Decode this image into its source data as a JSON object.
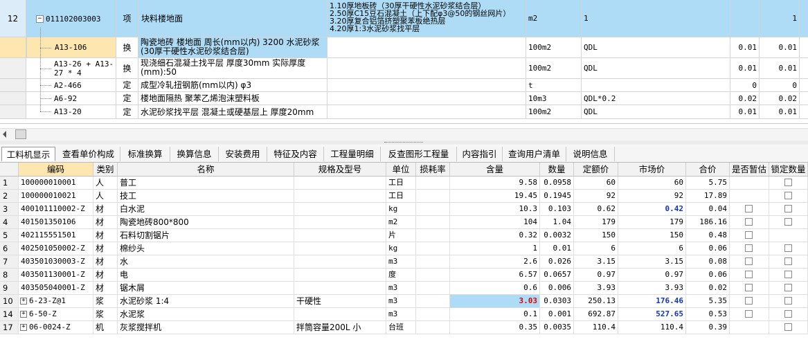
{
  "top_table": {
    "rows": [
      {
        "num": "12",
        "code": "011102003003",
        "type": "项",
        "name": "块料楼地面",
        "features": [
          "1.10厚地板砖（30厚干硬性水泥砂浆结合层）",
          "2.50厚C15豆石混凝土（上下配φ3@50的钢丝网片）",
          "3.20厚复合铝箔挤塑聚苯板绝热层",
          "4.20厚1:3水泥砂浆找平层"
        ],
        "unit": "m2",
        "qty_expr": "1",
        "col_a": "",
        "col_b": "1"
      },
      {
        "num": "",
        "code": "A13-106",
        "type": "换",
        "name": "陶瓷地砖 楼地面 周长(mm以内) 3200 水泥砂浆 (30厚干硬性水泥砂浆结合层)",
        "features": [],
        "unit": "100m2",
        "qty_expr": "QDL",
        "col_a": "0.01",
        "col_b": "0.01"
      },
      {
        "num": "",
        "code": "A13-26 + A13-27 * 4",
        "type": "换",
        "name": "现浇细石混凝土找平层 厚度30mm 实际厚度(mm):50",
        "features": [],
        "unit": "100m2",
        "qty_expr": "QDL",
        "col_a": "0.01",
        "col_b": "0.01"
      },
      {
        "num": "",
        "code": "A2-466",
        "type": "定",
        "name": "成型冷轧扭钢筋(mm以内) φ3",
        "features": [],
        "unit": "t",
        "qty_expr": "",
        "col_a": "0",
        "col_b": "0"
      },
      {
        "num": "",
        "code": "A6-92",
        "type": "定",
        "name": "楼地面隔热 聚苯乙烯泡沫塑料板",
        "features": [],
        "unit": "10m3",
        "qty_expr": "QDL*0.2",
        "col_a": "0.02",
        "col_b": "0.02"
      },
      {
        "num": "",
        "code": "A13-20",
        "type": "定",
        "name": "水泥砂浆找平层 混凝土或硬基层上 厚度20mm",
        "features": [],
        "unit": "100m2",
        "qty_expr": "QDL",
        "col_a": "0.01",
        "col_b": "0.01"
      }
    ],
    "tree_expand_symbol": "−"
  },
  "tabs": [
    "工料机显示",
    "查看单价构成",
    "标准换算",
    "换算信息",
    "安装费用",
    "特征及内容",
    "工程量明细",
    "反查图形工程量",
    "内容指引",
    "查询用户清单",
    "说明信息"
  ],
  "active_tab": "工料机显示",
  "resource_table": {
    "headers": [
      "编码",
      "类别",
      "名称",
      "规格及型号",
      "单位",
      "损耗率",
      "含量",
      "数量",
      "定额价",
      "市场价",
      "合价",
      "是否暂估",
      "锁定数量"
    ],
    "rows": [
      {
        "idx": "1",
        "expand": "",
        "code": "100000010001",
        "cat": "人",
        "name": "普工",
        "spec": "",
        "unit": "工日",
        "loss": "",
        "content": "9.58",
        "qty": "0.0958",
        "quota": "60",
        "market": "60",
        "total": "5.75",
        "est": false,
        "lock": true,
        "market_style": ""
      },
      {
        "idx": "2",
        "expand": "",
        "code": "100000010021",
        "cat": "人",
        "name": "技工",
        "spec": "",
        "unit": "工日",
        "loss": "",
        "content": "19.45",
        "qty": "0.1945",
        "quota": "92",
        "market": "92",
        "total": "17.89",
        "est": false,
        "lock": true,
        "market_style": ""
      },
      {
        "idx": "3",
        "expand": "",
        "code": "400101110002-Z",
        "cat": "材",
        "name": "白水泥",
        "spec": "",
        "unit": "kg",
        "loss": "",
        "content": "10.3",
        "qty": "0.103",
        "quota": "0.62",
        "market": "0.42",
        "total": "0.04",
        "est": true,
        "lock": true,
        "market_style": "blue"
      },
      {
        "idx": "4",
        "expand": "",
        "code": "401501350106",
        "cat": "材",
        "name": "陶瓷地砖800*800",
        "spec": "",
        "unit": "m2",
        "loss": "",
        "content": "104",
        "qty": "1.04",
        "quota": "179",
        "market": "179",
        "total": "186.16",
        "est": true,
        "lock": true,
        "market_style": ""
      },
      {
        "idx": "5",
        "expand": "",
        "code": "402115551501",
        "cat": "材",
        "name": "石料切割锯片",
        "spec": "",
        "unit": "片",
        "loss": "",
        "content": "0.32",
        "qty": "0.0032",
        "quota": "150",
        "market": "150",
        "total": "0.48",
        "est": true,
        "lock": false,
        "market_style": ""
      },
      {
        "idx": "6",
        "expand": "",
        "code": "402501050002-Z",
        "cat": "材",
        "name": "棉纱头",
        "spec": "",
        "unit": "kg",
        "loss": "",
        "content": "1",
        "qty": "0.01",
        "quota": "6",
        "market": "6",
        "total": "0.06",
        "est": true,
        "lock": true,
        "market_style": ""
      },
      {
        "idx": "7",
        "expand": "",
        "code": "403501030003-Z",
        "cat": "材",
        "name": "水",
        "spec": "",
        "unit": "m3",
        "loss": "",
        "content": "2.6",
        "qty": "0.026",
        "quota": "3.15",
        "market": "3.15",
        "total": "0.08",
        "est": true,
        "lock": true,
        "market_style": ""
      },
      {
        "idx": "8",
        "expand": "",
        "code": "403501130001-Z",
        "cat": "材",
        "name": "电",
        "spec": "",
        "unit": "度",
        "loss": "",
        "content": "6.57",
        "qty": "0.0657",
        "quota": "0.97",
        "market": "0.97",
        "total": "0.06",
        "est": true,
        "lock": true,
        "market_style": ""
      },
      {
        "idx": "9",
        "expand": "",
        "code": "403505040001-Z",
        "cat": "材",
        "name": "锯木屑",
        "spec": "",
        "unit": "m3",
        "loss": "",
        "content": "0.6",
        "qty": "0.006",
        "quota": "3.93",
        "market": "3.93",
        "total": "0.02",
        "est": true,
        "lock": true,
        "market_style": ""
      },
      {
        "idx": "10",
        "expand": "+",
        "code": "6-23-Z@1",
        "cat": "浆",
        "name": "水泥砂浆 1:4",
        "spec": "干硬性",
        "unit": "m3",
        "loss": "",
        "content": "3.03",
        "qty": "0.0303",
        "quota": "250.13",
        "market": "176.46",
        "total": "5.35",
        "est": true,
        "lock": true,
        "market_style": "blue",
        "content_style": "red"
      },
      {
        "idx": "14",
        "expand": "+",
        "code": "6-50-Z",
        "cat": "浆",
        "name": "水泥浆",
        "spec": "",
        "unit": "m3",
        "loss": "",
        "content": "0.1",
        "qty": "0.001",
        "quota": "692.87",
        "market": "527.65",
        "total": "0.53",
        "est": true,
        "lock": true,
        "market_style": "blue"
      },
      {
        "idx": "17",
        "expand": "+",
        "code": "06-0024-Z",
        "cat": "机",
        "name": "灰浆搅拌机",
        "spec": "拌筒容量200L 小",
        "unit": "台班",
        "loss": "",
        "content": "0.35",
        "qty": "0.0035",
        "quota": "110.4",
        "market": "110.4",
        "total": "0.39",
        "est": false,
        "lock": true,
        "market_style": ""
      }
    ]
  },
  "colors": {
    "selected_row": "#aedcf6",
    "current_row": "#fde6b0",
    "highlight_value": "#1035c8",
    "warning_value": "#e00000"
  }
}
